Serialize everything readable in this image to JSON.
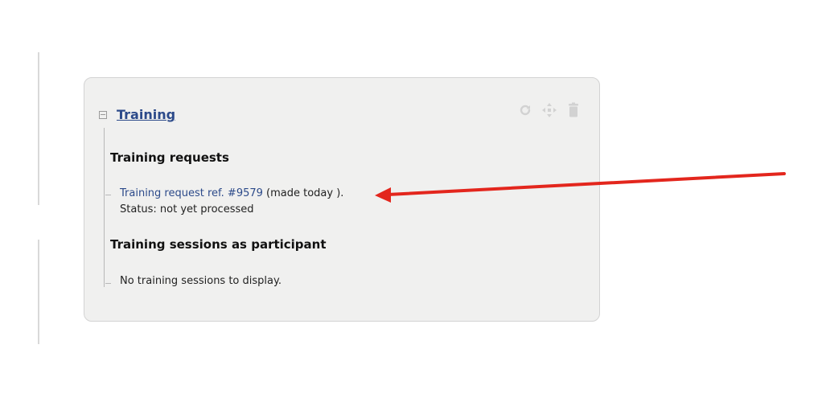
{
  "widget": {
    "title": "Training",
    "tools": {
      "refresh_icon": "refresh-icon",
      "move_icon": "move-icon",
      "delete_icon": "trash-icon"
    }
  },
  "requests": {
    "heading": "Training requests",
    "item": {
      "link_text": "Training request ref. #9579",
      "suffix": " (made today ).",
      "status": "Status: not yet processed"
    }
  },
  "sessions": {
    "heading": "Training sessions as participant",
    "empty_text": "No training sessions to display."
  },
  "annotation": {
    "color": "#e3261d"
  }
}
